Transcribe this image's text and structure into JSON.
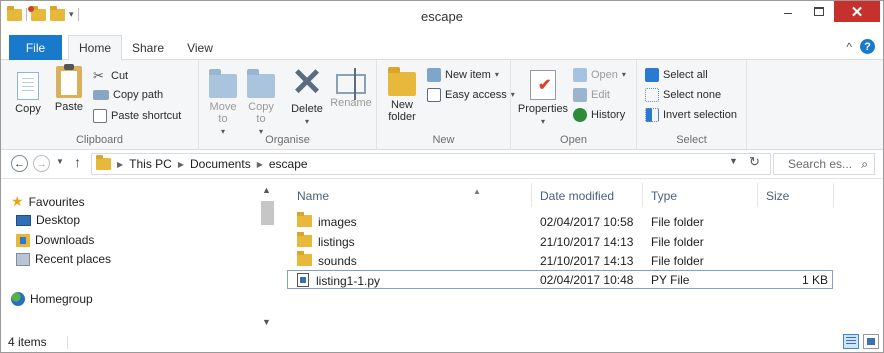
{
  "window": {
    "title": "escape",
    "minimize_glyph": "–",
    "close_glyph": "✕"
  },
  "tabs": {
    "file": "File",
    "home": "Home",
    "share": "Share",
    "view": "View"
  },
  "ribbon": {
    "clipboard": {
      "label": "Clipboard",
      "copy": "Copy",
      "paste": "Paste",
      "cut": "Cut",
      "copy_path": "Copy path",
      "paste_shortcut": "Paste shortcut"
    },
    "organise": {
      "label": "Organise",
      "move_to": "Move to",
      "copy_to": "Copy to",
      "delete": "Delete",
      "rename": "Rename"
    },
    "new": {
      "label": "New",
      "new_folder": "New folder",
      "new_item": "New item",
      "easy_access": "Easy access"
    },
    "open": {
      "label": "Open",
      "properties": "Properties",
      "open": "Open",
      "edit": "Edit",
      "history": "History"
    },
    "select": {
      "label": "Select",
      "select_all": "Select all",
      "select_none": "Select none",
      "invert_selection": "Invert selection"
    }
  },
  "address": {
    "crumbs": [
      "This PC",
      "Documents",
      "escape"
    ],
    "search_placeholder": "Search es..."
  },
  "navpane": {
    "favourites": "Favourites",
    "desktop": "Desktop",
    "downloads": "Downloads",
    "recent_places": "Recent places",
    "homegroup": "Homegroup"
  },
  "list": {
    "columns": {
      "name": "Name",
      "date_modified": "Date modified",
      "type": "Type",
      "size": "Size"
    },
    "rows": [
      {
        "name": "images",
        "date": "02/04/2017 10:58",
        "type": "File folder",
        "size": ""
      },
      {
        "name": "listings",
        "date": "21/10/2017 14:13",
        "type": "File folder",
        "size": ""
      },
      {
        "name": "sounds",
        "date": "21/10/2017 14:13",
        "type": "File folder",
        "size": ""
      },
      {
        "name": "listing1-1.py",
        "date": "02/04/2017 10:48",
        "type": "PY File",
        "size": "1 KB"
      }
    ]
  },
  "status": {
    "items": "4 items"
  },
  "colors": {
    "file_tab": "#1979ca",
    "close_button": "#c7312d",
    "folder": "#e8b83a",
    "selection_border": "#7da2ce"
  }
}
